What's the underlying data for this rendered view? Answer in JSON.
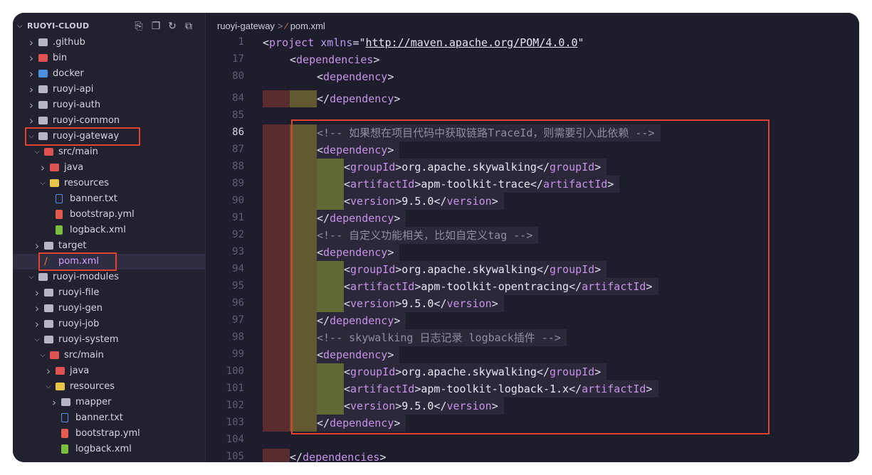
{
  "explorer": {
    "title": "RUOYI-CLOUD",
    "items": [
      {
        "label": ".github",
        "kind": "folder",
        "depth": 0,
        "expanded": false
      },
      {
        "label": "bin",
        "kind": "folder",
        "depth": 0,
        "expanded": false
      },
      {
        "label": "docker",
        "kind": "folder",
        "depth": 0,
        "expanded": false
      },
      {
        "label": "ruoyi-api",
        "kind": "folder",
        "depth": 0,
        "expanded": false
      },
      {
        "label": "ruoyi-auth",
        "kind": "folder",
        "depth": 0,
        "expanded": false
      },
      {
        "label": "ruoyi-common",
        "kind": "folder",
        "depth": 0,
        "expanded": false
      },
      {
        "label": "ruoyi-gateway",
        "kind": "folder",
        "depth": 0,
        "expanded": true
      },
      {
        "label": "src/main",
        "kind": "folder",
        "depth": 1,
        "expanded": true
      },
      {
        "label": "java",
        "kind": "folder",
        "depth": 2,
        "expanded": false
      },
      {
        "label": "resources",
        "kind": "folder",
        "depth": 2,
        "expanded": true
      },
      {
        "label": "banner.txt",
        "kind": "file",
        "depth": 3
      },
      {
        "label": "bootstrap.yml",
        "kind": "file",
        "depth": 3
      },
      {
        "label": "logback.xml",
        "kind": "file",
        "depth": 3
      },
      {
        "label": "target",
        "kind": "folder",
        "depth": 1,
        "expanded": false
      },
      {
        "label": "pom.xml",
        "kind": "file",
        "depth": 1,
        "selected": true
      },
      {
        "label": "ruoyi-modules",
        "kind": "folder",
        "depth": 0,
        "expanded": true
      },
      {
        "label": "ruoyi-file",
        "kind": "folder",
        "depth": 1,
        "expanded": false
      },
      {
        "label": "ruoyi-gen",
        "kind": "folder",
        "depth": 1,
        "expanded": false
      },
      {
        "label": "ruoyi-job",
        "kind": "folder",
        "depth": 1,
        "expanded": false
      },
      {
        "label": "ruoyi-system",
        "kind": "folder",
        "depth": 1,
        "expanded": true
      },
      {
        "label": "src/main",
        "kind": "folder",
        "depth": 2,
        "expanded": true
      },
      {
        "label": "java",
        "kind": "folder",
        "depth": 3,
        "expanded": false
      },
      {
        "label": "resources",
        "kind": "folder",
        "depth": 3,
        "expanded": true
      },
      {
        "label": "mapper",
        "kind": "folder",
        "depth": 4,
        "expanded": false
      },
      {
        "label": "banner.txt",
        "kind": "file",
        "depth": 4
      },
      {
        "label": "bootstrap.yml",
        "kind": "file",
        "depth": 4
      },
      {
        "label": "logback.xml",
        "kind": "file",
        "depth": 4
      }
    ]
  },
  "breadcrumb": {
    "folder": "ruoyi-gateway",
    "sep": ">",
    "file": "pom.xml"
  },
  "editor": {
    "active_line": "86",
    "lines": [
      {
        "n": "1",
        "text": "<project xmlns=\"http://maven.apache.org/POM/4.0.0\""
      },
      {
        "n": "17",
        "text": "<dependencies>"
      },
      {
        "n": "80",
        "text": "<dependency>"
      },
      {
        "n": "84",
        "text": "</dependency>"
      },
      {
        "n": "85",
        "text": ""
      },
      {
        "n": "86",
        "text": "<!-- 如果想在项目代码中获取链路TraceId，则需要引入此依赖 -->"
      },
      {
        "n": "87",
        "text": "<dependency>"
      },
      {
        "n": "88",
        "text": "<groupId>org.apache.skywalking</groupId>"
      },
      {
        "n": "89",
        "text": "<artifactId>apm-toolkit-trace</artifactId>"
      },
      {
        "n": "90",
        "text": "<version>9.5.0</version>"
      },
      {
        "n": "91",
        "text": "</dependency>"
      },
      {
        "n": "92",
        "text": "<!-- 自定义功能相关，比如自定义tag -->"
      },
      {
        "n": "93",
        "text": "<dependency>"
      },
      {
        "n": "94",
        "text": "<groupId>org.apache.skywalking</groupId>"
      },
      {
        "n": "95",
        "text": "<artifactId>apm-toolkit-opentracing</artifactId>"
      },
      {
        "n": "96",
        "text": "<version>9.5.0</version>"
      },
      {
        "n": "97",
        "text": "</dependency>"
      },
      {
        "n": "98",
        "text": "<!-- skywalking 日志记录 logback插件 -->"
      },
      {
        "n": "99",
        "text": "<dependency>"
      },
      {
        "n": "100",
        "text": "<groupId>org.apache.skywalking</groupId>"
      },
      {
        "n": "101",
        "text": "<artifactId>apm-toolkit-logback-1.x</artifactId>"
      },
      {
        "n": "102",
        "text": "<version>9.5.0</version>"
      },
      {
        "n": "103",
        "text": "</dependency>"
      },
      {
        "n": "104",
        "text": ""
      },
      {
        "n": "105",
        "text": "</dependencies>"
      }
    ]
  },
  "colors": {
    "annotation_red": "#e2432f",
    "tag": "#c792ea",
    "background": "#1e1d2b"
  }
}
